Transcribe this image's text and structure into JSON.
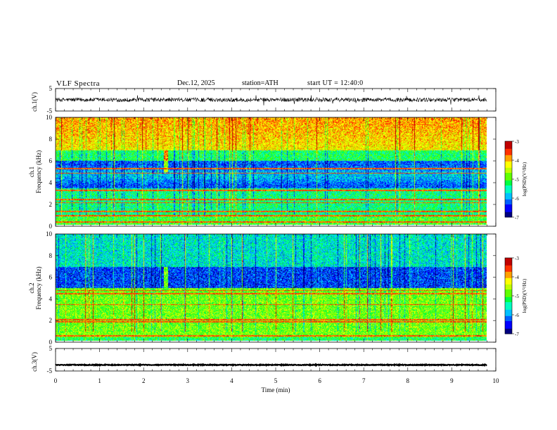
{
  "header": {
    "title": "VLF  Spectra",
    "date": "Dec.12, 2025",
    "station": "station=ATH",
    "start_ut": "start  UT  =   12:40:0"
  },
  "colors": {
    "palette": [
      "#000000",
      "#000080",
      "#0000ff",
      "#0080ff",
      "#00ffff",
      "#00ff80",
      "#00ff00",
      "#80ff00",
      "#ffff00",
      "#ff8000",
      "#ff0000",
      "#ffffff"
    ]
  },
  "chart_data": [
    {
      "type": "line",
      "panel": "ch1-waveform",
      "ylabel": "ch.1(V)",
      "ylim": [
        -5,
        5
      ],
      "yticks": [
        "5",
        "-5"
      ],
      "xlim": [
        0,
        10
      ],
      "series": [
        {
          "baseline": 0.0,
          "amplitude_range": [
            -2.5,
            2.0
          ]
        }
      ]
    },
    {
      "type": "heatmap",
      "panel": "ch1-spectrogram",
      "ylabel": "ch.1\nFrequency (kHz)",
      "ylabel_lines": [
        "ch.1",
        "Frequency  (kHz)"
      ],
      "ylim": [
        0,
        10
      ],
      "yticks": [
        "0",
        "2",
        "4",
        "6",
        "8",
        "10"
      ],
      "xlim": [
        0,
        9.8
      ],
      "colorbar": {
        "label": "log(PSD)(V²/Hz)",
        "range": [
          -7,
          -3
        ],
        "ticks": [
          "-3",
          "-4",
          "-5",
          "-6",
          "-7"
        ]
      },
      "features": {
        "high_band_kHz": [
          7,
          10
        ],
        "high_band_level": -4.2,
        "mid_level": -5.2,
        "quiet_band_kHz": [
          3.5,
          6
        ],
        "quiet_band_level": -6.0,
        "low_band_kHz": [
          1,
          3
        ],
        "low_band_level": -5.0,
        "narrowband_lines_kHz": [
          0.4,
          1.0,
          1.4,
          2.2,
          2.5,
          3.3,
          4.9,
          5.3
        ],
        "burst_near_min": 2.5
      }
    },
    {
      "type": "heatmap",
      "panel": "ch2-spectrogram",
      "ylabel_lines": [
        "ch.2",
        "Frequency  (kHz)"
      ],
      "ylim": [
        0,
        10
      ],
      "yticks": [
        "0",
        "2",
        "4",
        "6",
        "8",
        "10"
      ],
      "xlim": [
        0,
        9.8
      ],
      "colorbar": {
        "label": "log(PSD)(V²/Hz)",
        "range": [
          -7,
          -3
        ],
        "ticks": [
          "-3",
          "-4",
          "-5",
          "-6",
          "-7"
        ]
      },
      "features": {
        "high_band_kHz": [
          6,
          10
        ],
        "high_band_level": -5.6,
        "quiet_band_kHz": [
          5,
          7
        ],
        "quiet_band_level": -6.3,
        "low_band_kHz": [
          0.5,
          4.5
        ],
        "low_band_level": -4.8,
        "narrowband_lines_kHz": [
          0.6,
          1.9,
          2.1,
          3.5,
          4.5,
          4.8
        ],
        "burst_near_min": 2.5
      }
    },
    {
      "type": "line",
      "panel": "ch3-waveform",
      "ylabel": "ch.3(V)",
      "ylim": [
        -5,
        5
      ],
      "yticks": [
        "5",
        "-5"
      ],
      "xlim": [
        0,
        10
      ],
      "series": [
        {
          "baseline": -2.3,
          "amplitude_range": [
            -2.6,
            -2.0
          ]
        }
      ]
    }
  ],
  "xaxis": {
    "label": "Time  (min)",
    "ticks": [
      "0",
      "1",
      "2",
      "3",
      "4",
      "5",
      "6",
      "7",
      "8",
      "9",
      "10"
    ],
    "range": [
      0,
      10
    ]
  }
}
